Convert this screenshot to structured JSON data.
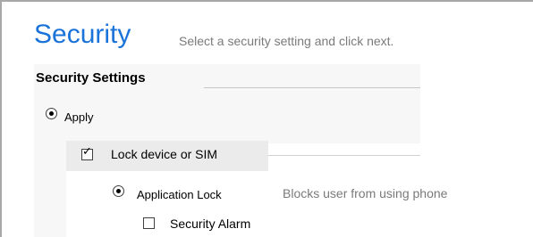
{
  "header": {
    "title": "Security",
    "subtitle": "Select a security setting and click next."
  },
  "security_settings": {
    "group_title": "Security Settings",
    "apply_option": {
      "label": "Apply",
      "selected": true
    },
    "lock_device": {
      "label": "Lock device or SIM",
      "checked": true
    },
    "application_lock": {
      "label": "Application Lock",
      "description": "Blocks user from using phone",
      "selected": true
    },
    "security_alarm": {
      "label": "Security Alarm",
      "checked": false
    }
  },
  "colors": {
    "title": "#1a73d9",
    "subtitle": "#7a7a7a",
    "group_background": "#f7f7f7"
  }
}
